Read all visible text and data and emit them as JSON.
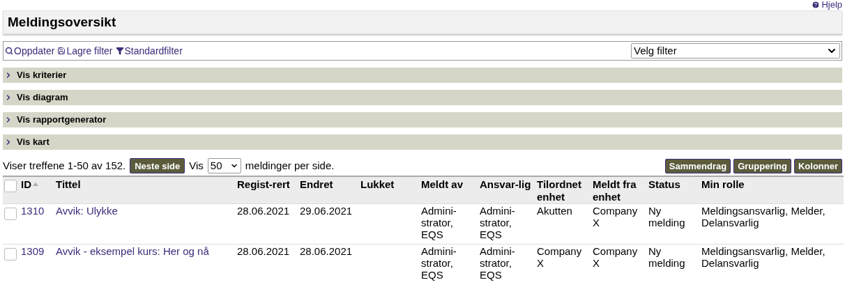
{
  "help_link": "Hjelp",
  "page_title": "Meldingsoversikt",
  "toolbar": {
    "actions": [
      {
        "kind": "search",
        "label": "Oppdater"
      },
      {
        "kind": "save",
        "label": "Lagre filter"
      },
      {
        "kind": "filter",
        "label": "Standardfilter"
      }
    ],
    "filter_select": "Velg filter"
  },
  "sections": [
    {
      "label": "Vis kriterier",
      "expanded": false
    },
    {
      "label": "Vis diagram",
      "expanded": false
    },
    {
      "label": "Vis rapportgenerator",
      "expanded": false
    },
    {
      "label": "Vis kart",
      "expanded": false
    }
  ],
  "paging": {
    "summary": "Viser treffene 1-50 av 152.",
    "next_button": "Neste side",
    "show_label": "Vis",
    "per_page": "50",
    "per_page_suffix": "meldinger per side."
  },
  "view_buttons": [
    "Sammendrag",
    "Gruppering",
    "Kolonner"
  ],
  "table": {
    "select_all_checked": false,
    "columns": [
      {
        "label": "ID",
        "sorted": true
      },
      {
        "label": "Tittel",
        "sorted": false
      },
      {
        "label": "Regist-rert",
        "sorted": false
      },
      {
        "label": "Endret",
        "sorted": false
      },
      {
        "label": "Lukket",
        "sorted": false
      },
      {
        "label": "Meldt av",
        "sorted": false
      },
      {
        "label": "Ansvar-lig",
        "sorted": false
      },
      {
        "label": "Tilordnet enhet",
        "sorted": false
      },
      {
        "label": "Meldt fra enhet",
        "sorted": false
      },
      {
        "label": "Status",
        "sorted": false
      },
      {
        "label": "Min rolle",
        "sorted": false
      }
    ],
    "rows": [
      {
        "checked": false,
        "cells": [
          "1310",
          "Avvik: Ulykke",
          "28.06.2021",
          "29.06.2021",
          "",
          "Admini-strator, EQS",
          "Admini-strator, EQS",
          "Akutten",
          "Company X",
          "Ny melding",
          "Meldingsansvarlig, Melder, Delansvarlig"
        ]
      },
      {
        "checked": false,
        "cells": [
          "1309",
          "Avvik - eksempel kurs: Her og nå",
          "28.06.2021",
          "28.06.2021",
          "",
          "Admini-strator, EQS",
          "Admini-strator, EQS",
          "Company X",
          "Company X",
          "Ny melding",
          "Meldingsansvarlig, Melder, Delansvarlig"
        ]
      }
    ]
  }
}
